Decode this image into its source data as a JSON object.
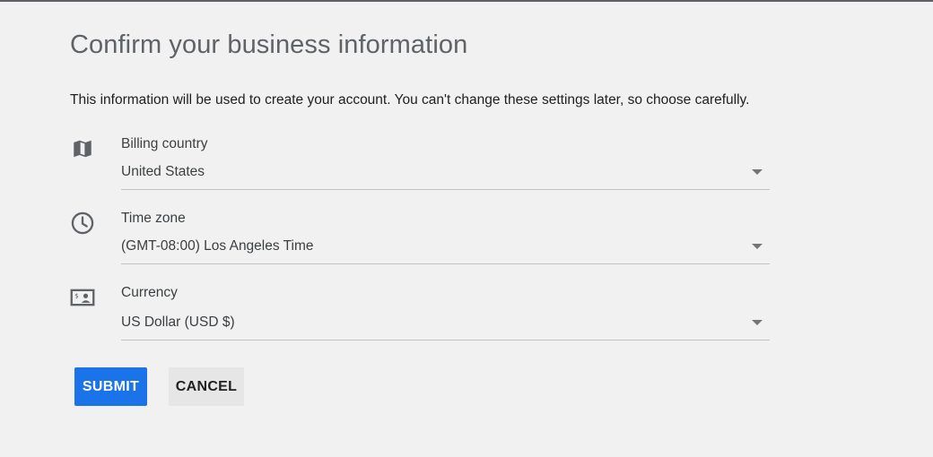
{
  "page": {
    "title": "Confirm your business information",
    "intro": "This information will be used to create your account. You can't change these settings later, so choose carefully."
  },
  "fields": [
    {
      "icon": "map-icon",
      "label": "Billing country",
      "value": "United States"
    },
    {
      "icon": "clock-icon",
      "label": "Time zone",
      "value": "(GMT-08:00) Los Angeles Time"
    },
    {
      "icon": "currency-icon",
      "label": "Currency",
      "value": "US Dollar (USD $)"
    }
  ],
  "actions": {
    "submit_label": "SUBMIT",
    "cancel_label": "CANCEL"
  },
  "colors": {
    "background": "#f1f1f1",
    "primary": "#1a73e8",
    "icon": "#5f6368",
    "secondary_button": "#e6e6e6"
  }
}
